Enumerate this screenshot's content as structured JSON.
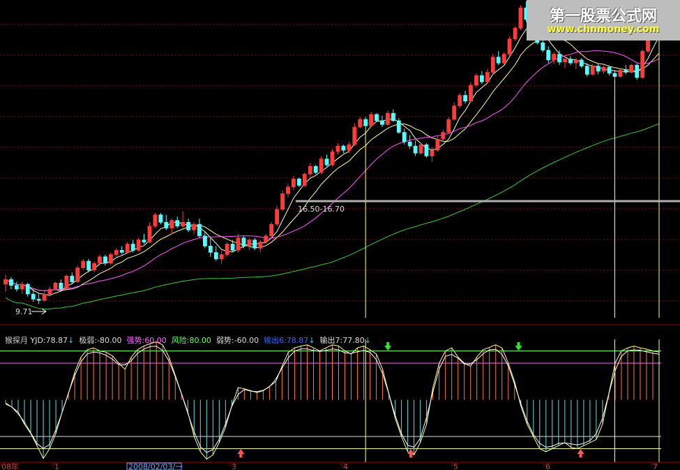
{
  "watermark": {
    "title": "第一股票公式网",
    "url": "www.chnmoney.com"
  },
  "colors": {
    "up": "#ff3b3b",
    "down": "#55ffff",
    "ma5": "#ffffcc",
    "ma10": "#ffff80",
    "ma20": "#ff55ff",
    "ma60": "#33cc33",
    "grid": "#a00000",
    "signal": "#ffff99",
    "osc_line": "#ffff88",
    "strong": "#ff66ff",
    "risk": "#66ff66"
  },
  "price_labels": {
    "low_label": "9.71",
    "range_label": "16.50-16.70"
  },
  "indicator": {
    "name": "猴探月",
    "yjd": {
      "label": "YJD:78.87",
      "arrow": "↓"
    },
    "jiruo": "极弱:-80.00",
    "qiangshi": "强势:60.00",
    "fengxian": "风险:80.00",
    "ruoshi": "弱势:-60.00",
    "output6": {
      "label": "输出6:78.87",
      "arrow": "↓"
    },
    "output7": {
      "label": "输出7:77.80",
      "arrow": "↓"
    }
  },
  "x_axis": {
    "ticks": [
      "08年",
      "1",
      "2008/02/03/一",
      "3",
      "4",
      "5",
      "6",
      "7"
    ]
  },
  "chart_data": {
    "type": "candlestick",
    "price_scale": "log",
    "ylim": [
      9.2,
      32.0
    ],
    "annotations": {
      "low": 9.71,
      "range": [
        16.5,
        16.7
      ]
    },
    "candles": [
      [
        10.5,
        10.9,
        10.2,
        10.7
      ],
      [
        10.7,
        10.8,
        10.3,
        10.45
      ],
      [
        10.45,
        10.6,
        10.2,
        10.3
      ],
      [
        10.3,
        10.6,
        10.1,
        10.5
      ],
      [
        10.5,
        10.55,
        10.0,
        10.1
      ],
      [
        10.1,
        10.3,
        9.8,
        9.9
      ],
      [
        9.9,
        10.1,
        9.71,
        9.85
      ],
      [
        9.85,
        10.2,
        9.8,
        10.1
      ],
      [
        10.1,
        10.4,
        10.0,
        10.3
      ],
      [
        10.3,
        10.6,
        10.25,
        10.55
      ],
      [
        10.55,
        10.7,
        10.2,
        10.3
      ],
      [
        10.3,
        10.9,
        10.25,
        10.85
      ],
      [
        10.85,
        11.0,
        10.5,
        10.6
      ],
      [
        10.6,
        11.3,
        10.55,
        11.2
      ],
      [
        11.2,
        11.6,
        11.1,
        11.5
      ],
      [
        11.5,
        11.6,
        11.0,
        11.1
      ],
      [
        11.1,
        11.5,
        11.0,
        11.4
      ],
      [
        11.4,
        11.8,
        11.3,
        11.7
      ],
      [
        11.7,
        11.8,
        11.3,
        11.4
      ],
      [
        11.4,
        11.9,
        11.35,
        11.8
      ],
      [
        11.8,
        12.1,
        11.7,
        12.0
      ],
      [
        12.0,
        12.2,
        11.8,
        11.9
      ],
      [
        11.9,
        12.4,
        11.85,
        12.3
      ],
      [
        12.3,
        12.5,
        11.9,
        12.0
      ],
      [
        12.0,
        12.6,
        11.95,
        12.5
      ],
      [
        12.5,
        12.8,
        12.3,
        12.4
      ],
      [
        12.4,
        13.4,
        12.35,
        13.2
      ],
      [
        13.2,
        13.9,
        13.1,
        13.8
      ],
      [
        13.8,
        13.9,
        13.3,
        13.4
      ],
      [
        13.4,
        13.8,
        13.0,
        13.1
      ],
      [
        13.1,
        13.6,
        12.8,
        13.5
      ],
      [
        13.5,
        13.7,
        13.1,
        13.2
      ],
      [
        13.2,
        14.0,
        13.1,
        13.4
      ],
      [
        13.4,
        13.6,
        12.9,
        13.0
      ],
      [
        13.0,
        13.4,
        12.8,
        13.3
      ],
      [
        13.3,
        13.6,
        12.6,
        12.7
      ],
      [
        12.7,
        12.9,
        12.1,
        12.2
      ],
      [
        12.2,
        12.6,
        11.7,
        11.9
      ],
      [
        11.9,
        12.2,
        11.5,
        11.6
      ],
      [
        11.6,
        12.0,
        11.4,
        11.8
      ],
      [
        11.8,
        12.4,
        11.7,
        12.3
      ],
      [
        12.3,
        12.5,
        11.9,
        12.0
      ],
      [
        12.0,
        12.8,
        11.9,
        12.6
      ],
      [
        12.6,
        12.7,
        12.1,
        12.2
      ],
      [
        12.2,
        12.6,
        12.0,
        12.5
      ],
      [
        12.5,
        12.6,
        12.0,
        12.1
      ],
      [
        12.1,
        12.5,
        11.9,
        12.4
      ],
      [
        12.4,
        12.8,
        12.3,
        12.7
      ],
      [
        12.7,
        13.4,
        12.6,
        13.3
      ],
      [
        13.3,
        14.3,
        13.2,
        14.1
      ],
      [
        14.1,
        15.2,
        14.0,
        15.0
      ],
      [
        15.0,
        15.6,
        14.8,
        15.4
      ],
      [
        15.4,
        16.1,
        15.2,
        15.9
      ],
      [
        15.9,
        16.0,
        15.4,
        15.5
      ],
      [
        15.5,
        16.3,
        15.4,
        16.2
      ],
      [
        16.2,
        16.9,
        16.0,
        16.7
      ],
      [
        16.7,
        16.8,
        16.2,
        16.3
      ],
      [
        16.3,
        17.4,
        16.2,
        17.2
      ],
      [
        17.2,
        17.5,
        16.7,
        16.8
      ],
      [
        16.8,
        17.9,
        16.7,
        17.7
      ],
      [
        17.7,
        18.3,
        17.5,
        18.1
      ],
      [
        18.1,
        18.2,
        17.6,
        17.8
      ],
      [
        17.8,
        18.4,
        17.6,
        18.2
      ],
      [
        18.2,
        19.8,
        18.1,
        19.5
      ],
      [
        19.5,
        20.3,
        19.4,
        20.1
      ],
      [
        20.1,
        20.3,
        19.4,
        19.6
      ],
      [
        19.6,
        20.7,
        19.5,
        20.5
      ],
      [
        20.5,
        20.6,
        19.9,
        20.0
      ],
      [
        20.0,
        20.4,
        19.5,
        19.7
      ],
      [
        19.7,
        20.8,
        19.6,
        20.6
      ],
      [
        20.6,
        20.9,
        19.9,
        20.0
      ],
      [
        20.0,
        20.2,
        19.0,
        19.1
      ],
      [
        19.1,
        19.4,
        18.2,
        18.4
      ],
      [
        18.4,
        18.9,
        17.9,
        18.1
      ],
      [
        18.1,
        18.5,
        17.4,
        17.6
      ],
      [
        17.6,
        18.3,
        17.5,
        18.2
      ],
      [
        18.2,
        18.3,
        17.3,
        17.4
      ],
      [
        17.4,
        18.0,
        17.0,
        17.8
      ],
      [
        17.8,
        18.8,
        17.7,
        18.6
      ],
      [
        18.6,
        19.3,
        18.4,
        19.1
      ],
      [
        19.1,
        20.3,
        19.0,
        20.1
      ],
      [
        20.1,
        21.5,
        20.0,
        21.2
      ],
      [
        21.2,
        22.3,
        21.0,
        22.1
      ],
      [
        22.1,
        22.5,
        21.4,
        21.6
      ],
      [
        21.6,
        23.3,
        21.5,
        23.0
      ],
      [
        23.0,
        24.1,
        22.8,
        23.9
      ],
      [
        23.9,
        24.3,
        23.1,
        23.3
      ],
      [
        23.3,
        24.5,
        23.2,
        24.2
      ],
      [
        24.2,
        26.0,
        24.0,
        25.7
      ],
      [
        25.7,
        26.3,
        24.9,
        25.1
      ],
      [
        25.1,
        26.2,
        25.0,
        26.0
      ],
      [
        26.0,
        27.9,
        25.8,
        27.6
      ],
      [
        27.6,
        29.0,
        27.4,
        28.8
      ],
      [
        28.8,
        31.5,
        28.6,
        31.2
      ],
      [
        31.2,
        32.0,
        29.5,
        29.8
      ],
      [
        29.8,
        30.3,
        28.4,
        28.7
      ],
      [
        28.7,
        28.9,
        27.0,
        27.2
      ],
      [
        27.2,
        27.8,
        26.2,
        26.4
      ],
      [
        26.4,
        26.8,
        25.1,
        25.4
      ],
      [
        25.4,
        26.2,
        25.0,
        26.0
      ],
      [
        26.0,
        26.4,
        24.9,
        25.2
      ],
      [
        25.2,
        25.7,
        24.6,
        25.5
      ],
      [
        25.5,
        25.8,
        24.9,
        25.1
      ],
      [
        25.1,
        25.6,
        24.5,
        25.4
      ],
      [
        25.4,
        25.6,
        24.6,
        24.8
      ],
      [
        24.8,
        25.1,
        23.8,
        24.0
      ],
      [
        24.0,
        25.0,
        23.9,
        24.8
      ],
      [
        24.8,
        25.0,
        24.0,
        24.3
      ],
      [
        24.3,
        24.9,
        24.1,
        24.7
      ],
      [
        24.7,
        24.8,
        23.9,
        24.1
      ],
      [
        24.1,
        24.4,
        23.5,
        23.8
      ],
      [
        23.8,
        24.6,
        23.7,
        24.4
      ],
      [
        24.4,
        24.9,
        24.0,
        24.2
      ],
      [
        24.2,
        25.0,
        24.1,
        24.9
      ],
      [
        24.9,
        25.1,
        23.5,
        23.7
      ],
      [
        23.7,
        26.5,
        23.6,
        26.3
      ],
      [
        26.3,
        28.8,
        26.1,
        28.6
      ],
      [
        28.6,
        30.4,
        28.4,
        30.2
      ],
      [
        30.2,
        31.0,
        29.6,
        30.6
      ]
    ],
    "signal_bars": [
      65,
      110,
      146,
      155,
      180,
      188
    ],
    "oscillator": {
      "levels": {
        "fengxian": 80,
        "qiangshi": 60,
        "ruoshi": -60,
        "jiruo": -80
      },
      "ylim": [
        -100,
        100
      ],
      "values": [
        -5,
        -12,
        -20,
        -40,
        -55,
        -75,
        -96,
        -80,
        -55,
        -20,
        10,
        45,
        70,
        82,
        85,
        80,
        78,
        72,
        60,
        50,
        70,
        82,
        88,
        92,
        95,
        90,
        70,
        40,
        10,
        -20,
        -60,
        -85,
        -97,
        -90,
        -70,
        -45,
        -10,
        20,
        18,
        15,
        12,
        15,
        22,
        30,
        55,
        78,
        85,
        88,
        90,
        85,
        80,
        85,
        90,
        88,
        80,
        75,
        85,
        88,
        82,
        75,
        50,
        10,
        -30,
        -60,
        -85,
        -90,
        -70,
        -40,
        20,
        60,
        80,
        85,
        70,
        60,
        55,
        70,
        82,
        86,
        90,
        85,
        60,
        30,
        -10,
        -40,
        -60,
        -80,
        -85,
        -80,
        -75,
        -70,
        -78,
        -80,
        -75,
        -70,
        -65,
        -40,
        10,
        60,
        80,
        85,
        88,
        85,
        83,
        80,
        78
      ]
    }
  }
}
